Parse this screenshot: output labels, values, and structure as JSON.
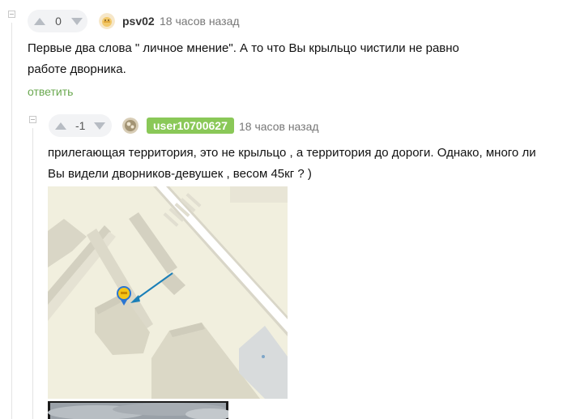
{
  "comments": [
    {
      "score": "0",
      "username": "psv02",
      "time": "18 часов назад",
      "text_lines": [
        "Первые два слова \" личное мнение\". А то что Вы крыльцо чистили не равно",
        "работе дворника."
      ],
      "reply_label": "ответить"
    },
    {
      "score": "-1",
      "username": "user10700627",
      "time": "18 часов назад",
      "text_lines": [
        "прилегающая территория, это не крыльцо , а территория до дороги. Однако, много ли",
        "Вы видели дворников-девушек , весом 45кг ? )"
      ]
    }
  ],
  "colors": {
    "username_badge": "#8ac858",
    "reply_link": "#6aa84f",
    "map_background": "#f1efde",
    "map_arrow": "#1a7fb8",
    "map_marker": "#f5c518"
  },
  "icons": [
    "collapse-icon",
    "upvote-icon",
    "downvote-icon",
    "avatar-icon",
    "map-marker-icon",
    "map-arrow-icon"
  ]
}
